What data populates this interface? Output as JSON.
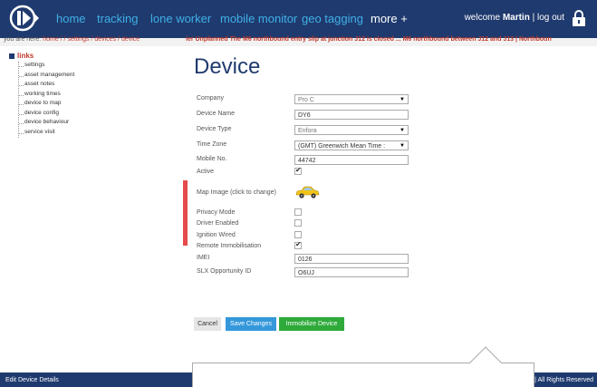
{
  "nav": {
    "items": [
      "home",
      "tracking",
      "lone worker",
      "mobile monitor",
      "geo tagging",
      "more +"
    ],
    "welcome_prefix": "welcome",
    "user": "Martin",
    "logout": "| log out"
  },
  "breadcrumb": {
    "prefix": "you are here:",
    "path": "home / / settings / devices / device"
  },
  "ticker": "ier Unplanned The M6 northbound entry slip at junction J12 is closed ...     M6 northbound between J12 and J13 | Northboun",
  "tree": {
    "root": "links",
    "items": [
      "settings",
      "asset management",
      "asset notes",
      "working times",
      "device to map",
      "device config",
      "device behaviour",
      "service visit"
    ]
  },
  "form": {
    "title": "Device",
    "company_label": "Company",
    "company_value": "Pro C",
    "device_name_label": "Device Name",
    "device_name_value": "DY6",
    "device_type_label": "Device Type",
    "device_type_value": "Enfora",
    "time_zone_label": "Time Zone",
    "time_zone_value": "(GMT) Greenwich Mean Time :",
    "mobile_label": "Mobile No.",
    "mobile_value": "44742",
    "active_label": "Active",
    "map_image_label": "Map Image (click to change)",
    "privacy_label": "Privacy Mode",
    "driver_label": "Driver Enabled",
    "ignition_label": "Ignition Wired",
    "remote_label": "Remote Immobilisation",
    "imei_label": "IMEI",
    "imei_value": "0126",
    "slx_label": "SLX Opportunity ID",
    "slx_value": "O6UJ"
  },
  "checkboxes": {
    "active": true,
    "privacy": false,
    "driver": false,
    "ignition": false,
    "remote": true
  },
  "buttons": {
    "cancel": "Cancel",
    "save": "Save Changes",
    "immobilize": "Immobilize Device"
  },
  "footer": {
    "left": "Edit Device Details",
    "right": "| All Rights Reserved"
  },
  "colors": {
    "nav_bg": "#1f3a6e",
    "nav_link": "#3fb0e8",
    "accent_red": "#c0392b",
    "save_blue": "#3498db",
    "immob_green": "#2eaa3a"
  }
}
